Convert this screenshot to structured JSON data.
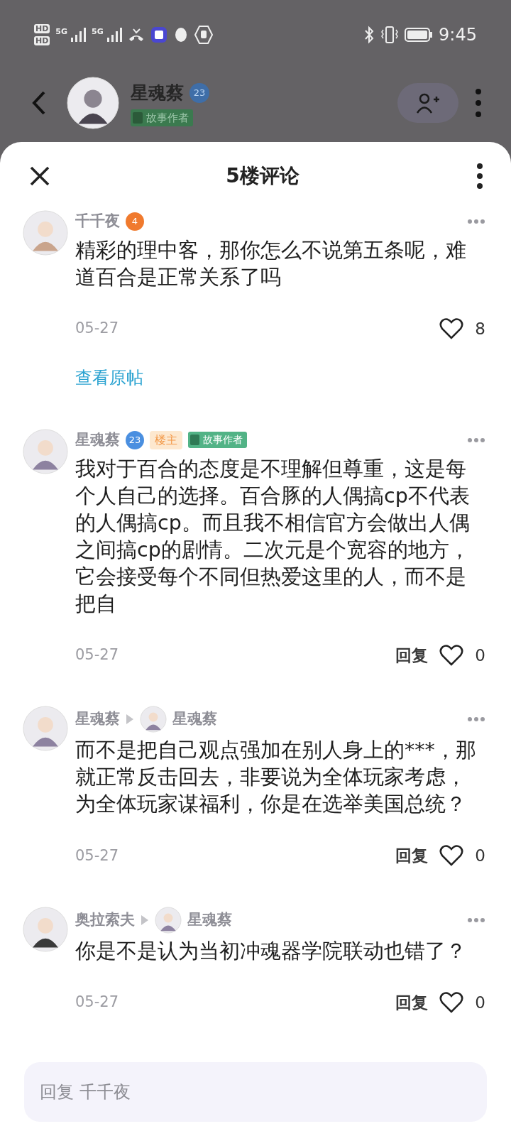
{
  "status_bar": {
    "sims": [
      "HD",
      "HD"
    ],
    "networks": [
      "5G",
      "5G"
    ],
    "time": "9:45"
  },
  "profile_header": {
    "name": "星魂蔡",
    "level": "23",
    "color": "#3f6ea8",
    "tag": "故事作者"
  },
  "sheet": {
    "title": "5楼评论"
  },
  "comments": [
    {
      "author": "千千夜",
      "level": "4",
      "color": "#f07a2e",
      "text": "精彩的理中客，那你怎么不说第五条呢，难道百合是正常关系了吗",
      "date": "05-27",
      "likes": "8",
      "link": "查看原帖",
      "liked": false
    },
    {
      "author": "星魂蔡",
      "level": "23",
      "color": "#4a8fe0",
      "owner_badge": "楼主",
      "tag": "故事作者",
      "text": "我对于百合的态度是不理解但尊重，这是每个人自己的选择。百合豚的人偶搞cp不代表的人偶搞cp。而且我不相信官方会做出人偶之间搞cp的剧情。二次元是个宽容的地方，它会接受每个不同但热爱这里的人，而不是把自",
      "date": "05-27",
      "reply": "回复",
      "likes": "0",
      "liked": false
    },
    {
      "author": "星魂蔡",
      "reply_to": "星魂蔡",
      "text": "而不是把自己观点强加在别人身上的***，那就正常反击回去，非要说为全体玩家考虑，为全体玩家谋福利，你是在选举美国总统？",
      "date": "05-27",
      "reply": "回复",
      "likes": "0",
      "liked": false
    },
    {
      "author": "奥拉索夫",
      "reply_to": "星魂蔡",
      "text": "你是不是认为当初冲魂器学院联动也错了？",
      "date": "05-27",
      "reply": "回复",
      "likes": "0",
      "liked": false
    }
  ],
  "reply_box": {
    "placeholder": "回复 千千夜"
  }
}
